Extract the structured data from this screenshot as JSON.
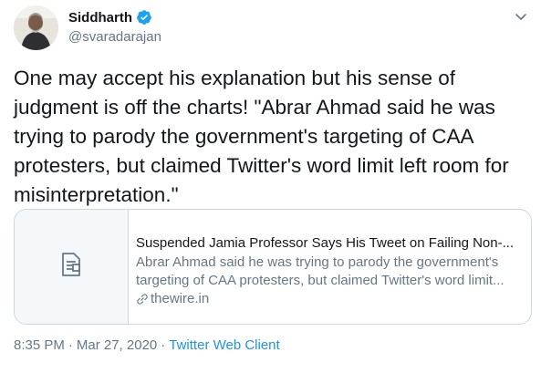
{
  "header": {
    "display_name": "Siddharth",
    "handle": "@svaradarajan",
    "verified_icon": "verified-badge-icon",
    "menu_icon": "chevron-down-icon"
  },
  "tweet": {
    "text": "One may accept his explanation but his sense of judgment is off the charts! \"Abrar Ahmad said he was trying to parody the government's targeting of CAA protesters, but claimed Twitter's word limit left room for misinterpretation.\""
  },
  "card": {
    "thumb_icon": "document-icon",
    "title": "Suspended Jamia Professor Says His Tweet on Failing Non-...",
    "desc_line1": "Abrar Ahmad said he was trying to parody the government's",
    "desc_line2": "targeting of CAA protesters, but claimed Twitter's word limit...",
    "link_icon": "link-icon",
    "domain": "thewire.in"
  },
  "meta": {
    "time": "8:35 PM",
    "separator": "·",
    "date": "Mar 27, 2020",
    "separator2": "·",
    "source": "Twitter Web Client"
  },
  "colors": {
    "text": "#14171a",
    "secondary": "#657786",
    "accent": "#1b95e0",
    "verified": "#1da1f2",
    "border": "#ccd6dd"
  }
}
